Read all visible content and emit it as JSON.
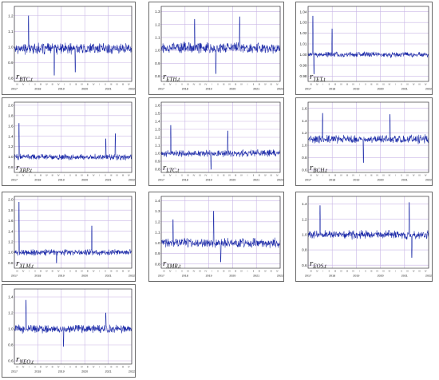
{
  "colors": {
    "series": "#1b2aa8",
    "grid": "#c9b6e6",
    "frame": "#6a6a6a"
  },
  "chart_data": [
    {
      "type": "line",
      "label_main": "r",
      "label_sub": "BTC,t",
      "yticks": [
        "1.2",
        "1.1",
        "1.0",
        "0.9",
        "0.8"
      ],
      "ylim": [
        0.78,
        1.26
      ],
      "xticks": [
        "2017",
        "2018",
        "2019",
        "2020",
        "2021",
        "2022"
      ],
      "quarter_labels": [
        "III",
        "IV",
        "I",
        "II",
        "III",
        "IV"
      ],
      "baseline": 0.99,
      "volatility": 0.028,
      "spikes": [
        [
          0.34,
          0.82
        ],
        [
          0.12,
          1.2
        ],
        [
          0.52,
          0.84
        ]
      ]
    },
    {
      "type": "line",
      "label_main": "r",
      "label_sub": "ETH,t",
      "yticks": [
        "1.3",
        "1.2",
        "1.1",
        "1.0",
        "0.9",
        "0.8"
      ],
      "ylim": [
        0.76,
        1.34
      ],
      "xticks": [
        "2017",
        "2018",
        "2019",
        "2020",
        "2021",
        "2022"
      ],
      "quarter_labels": [
        "III",
        "IV",
        "I",
        "II",
        "III",
        "IV"
      ],
      "baseline": 1.02,
      "volatility": 0.035,
      "spikes": [
        [
          0.46,
          0.82
        ],
        [
          0.66,
          1.26
        ],
        [
          0.28,
          1.24
        ]
      ]
    },
    {
      "type": "line",
      "label_main": "r",
      "label_sub": "TET,t",
      "yticks": [
        "1.04",
        "1.03",
        "1.02",
        "1.01",
        "1.00",
        "0.99",
        "0.98"
      ],
      "ylim": [
        0.975,
        1.045
      ],
      "xticks": [
        "2017",
        "2018",
        "2019",
        "2020",
        "2021",
        "2022"
      ],
      "quarter_labels": [
        "III",
        "IV",
        "I",
        "II",
        "III",
        "IV"
      ],
      "baseline": 1.0,
      "volatility": 0.002,
      "spikes": [
        [
          0.04,
          1.036
        ],
        [
          0.05,
          0.982
        ],
        [
          0.2,
          1.024
        ]
      ]
    },
    {
      "type": "line",
      "label_main": "r",
      "label_sub": "XRP,t",
      "yticks": [
        "2.0",
        "1.8",
        "1.6",
        "1.4",
        "1.2",
        "1.0",
        "0.8"
      ],
      "ylim": [
        0.7,
        2.06
      ],
      "xticks": [
        "2017",
        "2018",
        "2019",
        "2020",
        "2021",
        "2022"
      ],
      "quarter_labels": [
        "III",
        "IV",
        "I",
        "II",
        "III",
        "IV"
      ],
      "baseline": 1.0,
      "volatility": 0.045,
      "spikes": [
        [
          0.04,
          1.65
        ],
        [
          0.86,
          1.45
        ],
        [
          0.78,
          1.35
        ]
      ]
    },
    {
      "type": "line",
      "label_main": "r",
      "label_sub": "LTC,t",
      "yticks": [
        "1.6",
        "1.5",
        "1.4",
        "1.3",
        "1.2",
        "1.1",
        "1.0",
        "0.9",
        "0.8"
      ],
      "ylim": [
        0.76,
        1.64
      ],
      "xticks": [
        "2017",
        "2018",
        "2019",
        "2020",
        "2021",
        "2022"
      ],
      "quarter_labels": [
        "III",
        "IV",
        "I",
        "II",
        "III",
        "IV"
      ],
      "baseline": 1.0,
      "volatility": 0.035,
      "spikes": [
        [
          0.08,
          1.35
        ],
        [
          0.56,
          1.28
        ],
        [
          0.42,
          0.8
        ]
      ]
    },
    {
      "type": "line",
      "label_main": "r",
      "label_sub": "BCH,t",
      "yticks": [
        "1.6",
        "1.4",
        "1.2",
        "1.0",
        "0.8",
        "0.6"
      ],
      "ylim": [
        0.56,
        1.7
      ],
      "xticks": [
        "2017",
        "2018",
        "2019",
        "2020",
        "2021",
        "2022"
      ],
      "quarter_labels": [
        "III",
        "IV",
        "I",
        "II",
        "III",
        "IV"
      ],
      "baseline": 1.1,
      "volatility": 0.055,
      "spikes": [
        [
          0.12,
          1.52
        ],
        [
          0.68,
          1.5
        ],
        [
          0.46,
          0.72
        ]
      ]
    },
    {
      "type": "line",
      "label_main": "r",
      "label_sub": "XLM,t",
      "yticks": [
        "2.0",
        "1.8",
        "1.6",
        "1.4",
        "1.2",
        "1.0",
        "0.8"
      ],
      "ylim": [
        0.7,
        2.06
      ],
      "xticks": [
        "2017",
        "2018",
        "2019",
        "2020",
        "2021",
        "2022"
      ],
      "quarter_labels": [
        "III",
        "IV",
        "I",
        "II",
        "III",
        "IV"
      ],
      "baseline": 1.0,
      "volatility": 0.045,
      "spikes": [
        [
          0.04,
          1.95
        ],
        [
          0.66,
          1.5
        ],
        [
          0.36,
          0.8
        ]
      ]
    },
    {
      "type": "line",
      "label_main": "r",
      "label_sub": "XMR,t",
      "yticks": [
        "1.4",
        "1.3",
        "1.2",
        "1.1",
        "1.0",
        "0.9",
        "0.8"
      ],
      "ylim": [
        0.76,
        1.44
      ],
      "xticks": [
        "2017",
        "2018",
        "2019",
        "2020",
        "2021",
        "2022"
      ],
      "quarter_labels": [
        "III",
        "IV",
        "I",
        "II",
        "III",
        "IV"
      ],
      "baseline": 1.0,
      "volatility": 0.035,
      "spikes": [
        [
          0.44,
          1.3
        ],
        [
          0.5,
          0.82
        ],
        [
          0.1,
          1.22
        ]
      ]
    },
    {
      "type": "line",
      "label_main": "r",
      "label_sub": "EOS,t",
      "yticks": [
        "1.4",
        "1.2",
        "1.0",
        "0.8",
        "0.6"
      ],
      "ylim": [
        0.56,
        1.5
      ],
      "xticks": [
        "2017",
        "2018",
        "2019",
        "2020",
        "2021",
        "2022"
      ],
      "quarter_labels": [
        "III",
        "IV",
        "I",
        "II",
        "III",
        "IV"
      ],
      "baseline": 1.0,
      "volatility": 0.045,
      "spikes": [
        [
          0.84,
          1.42
        ],
        [
          0.1,
          1.38
        ],
        [
          0.86,
          0.7
        ]
      ]
    },
    {
      "type": "line",
      "label_main": "r",
      "label_sub": "NEO,t",
      "yticks": [
        "1.4",
        "1.2",
        "1.0",
        "0.8",
        "0.6"
      ],
      "ylim": [
        0.56,
        1.5
      ],
      "xticks": [
        "2017",
        "2018",
        "2019",
        "2020",
        "2021",
        "2022"
      ],
      "quarter_labels": [
        "III",
        "IV",
        "I",
        "II",
        "III",
        "IV"
      ],
      "baseline": 1.0,
      "volatility": 0.04,
      "spikes": [
        [
          0.1,
          1.36
        ],
        [
          0.42,
          0.78
        ],
        [
          0.78,
          1.2
        ]
      ]
    }
  ]
}
